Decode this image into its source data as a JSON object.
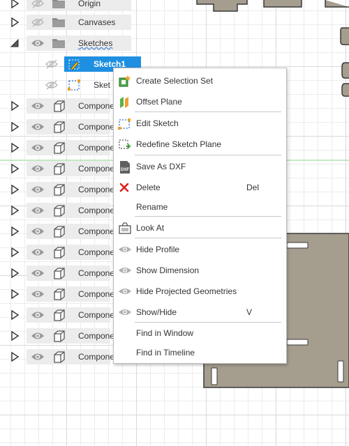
{
  "browser": {
    "rows": [
      {
        "label": "Origin",
        "type": "folder",
        "eye": "hidden",
        "expander": "collapsed"
      },
      {
        "label": "Canvases",
        "type": "folder",
        "eye": "hidden",
        "expander": "collapsed"
      },
      {
        "label": "Sketches",
        "type": "folder",
        "eye": "visible",
        "expander": "expanded"
      },
      {
        "label": "Sketch1",
        "type": "sketch",
        "eye": "hidden",
        "selected": true
      },
      {
        "label": "Sket",
        "type": "sketch",
        "eye": "hidden"
      },
      {
        "label": "Compone",
        "type": "component",
        "eye": "visible",
        "expander": "collapsed"
      },
      {
        "label": "Compone",
        "type": "component",
        "eye": "visible",
        "expander": "collapsed"
      },
      {
        "label": "Compone",
        "type": "component",
        "eye": "visible",
        "expander": "collapsed"
      },
      {
        "label": "Compone",
        "type": "component",
        "eye": "visible",
        "expander": "collapsed"
      },
      {
        "label": "Compone",
        "type": "component",
        "eye": "visible",
        "expander": "collapsed"
      },
      {
        "label": "Compone",
        "type": "component",
        "eye": "visible",
        "expander": "collapsed"
      },
      {
        "label": "Compone",
        "type": "component",
        "eye": "visible",
        "expander": "collapsed"
      },
      {
        "label": "Compone",
        "type": "component",
        "eye": "visible",
        "expander": "collapsed"
      },
      {
        "label": "Compone",
        "type": "component",
        "eye": "visible",
        "expander": "collapsed"
      },
      {
        "label": "Compone",
        "type": "component",
        "eye": "visible",
        "expander": "collapsed"
      },
      {
        "label": "Compone",
        "type": "component",
        "eye": "visible",
        "expander": "collapsed"
      },
      {
        "label": "Compone",
        "type": "component",
        "eye": "visible",
        "expander": "collapsed"
      },
      {
        "label": "Compone",
        "type": "component",
        "eye": "visible",
        "expander": "collapsed"
      }
    ]
  },
  "context_menu": {
    "items": [
      {
        "label": "Create Selection Set",
        "icon": "selection-set-icon"
      },
      {
        "label": "Offset Plane",
        "icon": "offset-plane-icon"
      },
      {
        "label": "Edit Sketch",
        "icon": "edit-sketch-icon"
      },
      {
        "label": "Redefine Sketch Plane",
        "icon": "redefine-plane-icon"
      },
      {
        "label": "Save As DXF",
        "icon": "dxf-file-icon"
      },
      {
        "label": "Delete",
        "icon": "delete-x-icon",
        "shortcut": "Del"
      },
      {
        "label": "Rename",
        "icon": ""
      },
      {
        "label": "Look At",
        "icon": "look-at-icon"
      },
      {
        "label": "Hide Profile",
        "icon": "eye-icon"
      },
      {
        "label": "Show Dimension",
        "icon": "eye-icon"
      },
      {
        "label": "Hide Projected Geometries",
        "icon": "eye-icon"
      },
      {
        "label": "Show/Hide",
        "icon": "eye-icon",
        "shortcut": "V"
      },
      {
        "label": "Find in Window",
        "icon": ""
      },
      {
        "label": "Find in Timeline",
        "icon": ""
      }
    ]
  },
  "colors": {
    "selection": "#1e8fe1",
    "part_fill": "#a59d8e",
    "part_stroke": "#3a3a3a",
    "axis_green": "#8fd08f",
    "delete_red": "#e02020"
  }
}
